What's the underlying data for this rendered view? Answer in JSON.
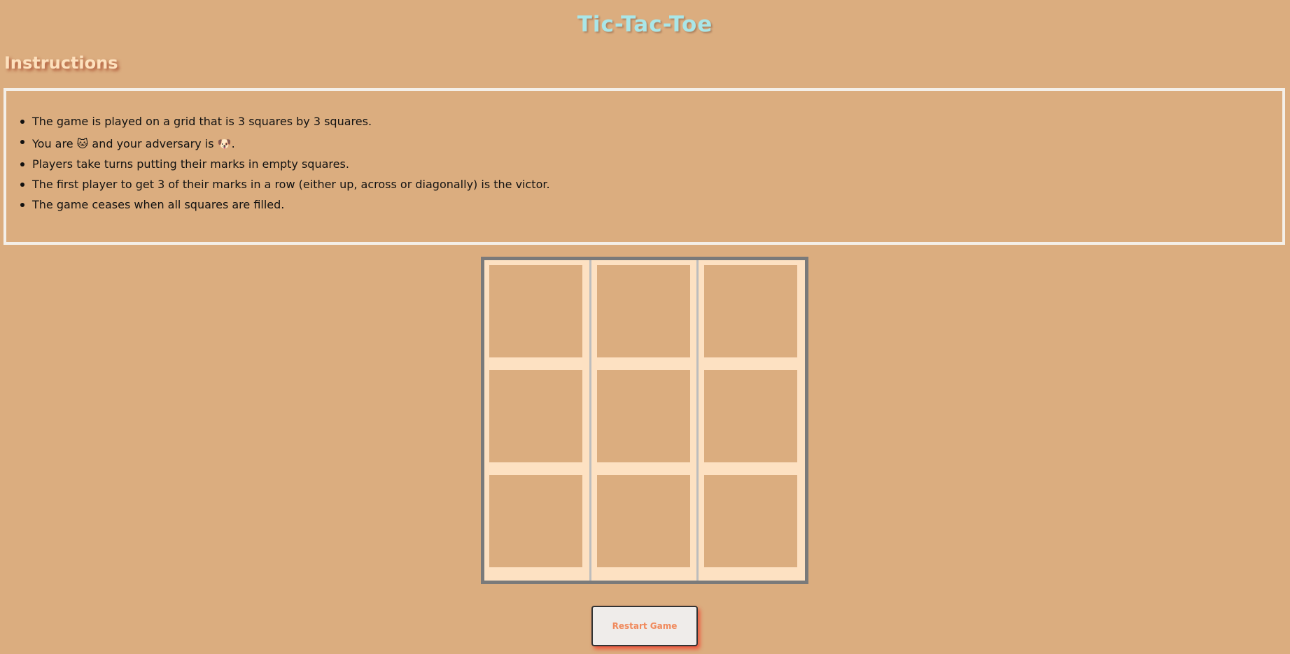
{
  "title": "Tic-Tac-Toe",
  "instructions": {
    "heading": "Instructions",
    "items": [
      {
        "text": "The game is played on a grid that is 3 squares by 3 squares."
      },
      {
        "before": "You are ",
        "player_mark": "🐱",
        "middle": " and your adversary is ",
        "adversary_mark": "🐶",
        "after": "."
      },
      {
        "text": "Players take turns putting their marks in empty squares."
      },
      {
        "text": "The first player to get 3 of their marks in a row (either up, across or diagonally) is the victor."
      },
      {
        "text": "The game ceases when all squares are filled."
      }
    ]
  },
  "board": {
    "cells": [
      "",
      "",
      "",
      "",
      "",
      "",
      "",
      "",
      ""
    ]
  },
  "restart_label": "Restart Game",
  "colors": {
    "background": "#dbad7f",
    "title": "#a9e6e8",
    "heading": "#fde0bd",
    "board_frame": "#7a7a7a",
    "cell_border": "#fde1c2",
    "button_text": "#f08a5d"
  }
}
